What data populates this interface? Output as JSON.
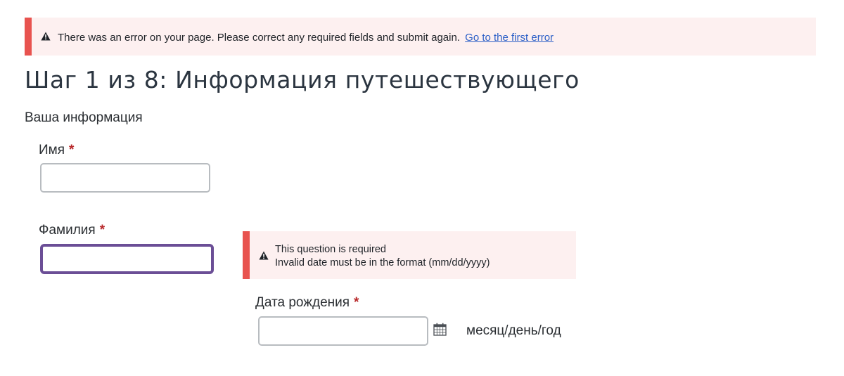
{
  "error_banner": {
    "message": "There was an error on your page. Please correct any required fields and submit again.",
    "link_text": "Go to the first error"
  },
  "page_title": "Шаг 1 из 8: Информация путешествующего",
  "section_title": "Ваша информация",
  "fields": {
    "first_name": {
      "label": "Имя",
      "required_mark": "*",
      "value": ""
    },
    "last_name": {
      "label": "Фамилия",
      "required_mark": "*",
      "value": ""
    },
    "birth_date": {
      "label": "Дата рождения",
      "required_mark": "*",
      "value": "",
      "format_hint": "месяц/день/год",
      "errors": [
        "This question is required",
        "Invalid date must be in the format (mm/dd/yyyy)"
      ]
    }
  },
  "colors": {
    "error_accent": "#e8534f",
    "error_background": "#fdf0f0",
    "link": "#2b5fc7",
    "required": "#b8282a",
    "focus_ring": "#6b4e96"
  },
  "icons": {
    "warning": "warning-triangle-icon",
    "calendar": "calendar-icon"
  }
}
